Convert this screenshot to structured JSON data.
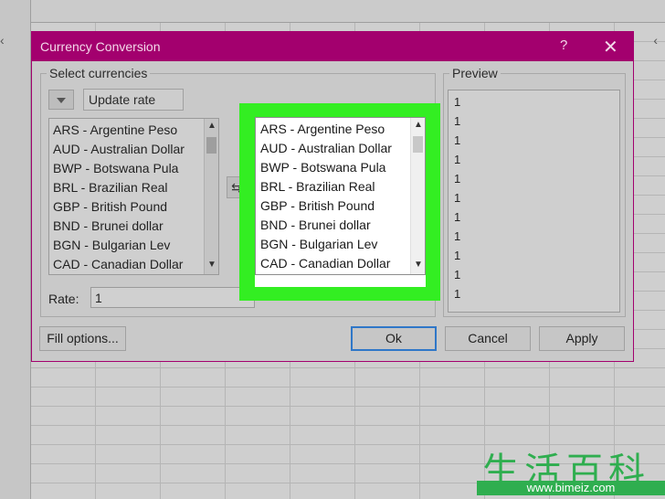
{
  "dialog": {
    "title": "Currency Conversion",
    "help": "?",
    "close": "✕"
  },
  "select_group": {
    "label": "Select currencies",
    "update_rate": "Update rate",
    "swap_icon": "⇆",
    "rate_label": "Rate:",
    "rate_value": "1"
  },
  "currency_list": [
    "ARS - Argentine Peso",
    "AUD - Australian Dollar",
    "BWP - Botswana Pula",
    "BRL - Brazilian Real",
    "GBP - British Pound",
    "BND - Brunei dollar",
    "BGN - Bulgarian Lev",
    "CAD - Canadian Dollar"
  ],
  "preview": {
    "label": "Preview",
    "values": [
      "1",
      "1",
      "1",
      "1",
      "1",
      "1",
      "1",
      "1",
      "1",
      "1",
      "1"
    ]
  },
  "buttons": {
    "fill_options": "Fill options...",
    "ok": "Ok",
    "cancel": "Cancel",
    "apply": "Apply"
  },
  "watermark": {
    "chars": "生活百科",
    "url": "www.bimeiz.com"
  },
  "colors": {
    "titlebar": "#a3006e",
    "highlight": "#33ee22",
    "ok_border": "#2f77c8"
  }
}
